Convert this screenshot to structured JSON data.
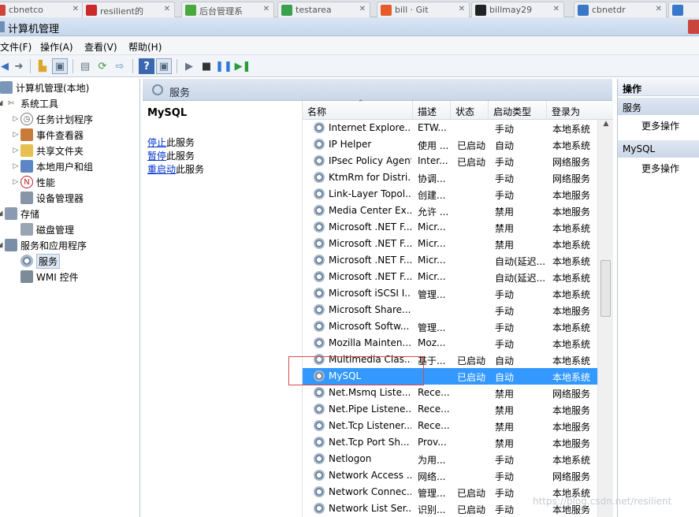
{
  "browser_tabs": [
    {
      "title": "cbnetco",
      "icon_color": "#d0433a"
    },
    {
      "title": "resilient的",
      "icon_color": "#cc2a2a"
    },
    {
      "title": "后台管理系",
      "icon_color": "#4aa83e"
    },
    {
      "title": "testarea",
      "icon_color": "#39a04c"
    },
    {
      "title": "bill · Git",
      "icon_color": "#e35c2a"
    },
    {
      "title": "billmay29",
      "icon_color": "#222222"
    },
    {
      "title": "cbnetdr",
      "icon_color": "#3a77c9"
    },
    {
      "title": "",
      "icon_color": "#3a77c9"
    }
  ],
  "window": {
    "title": "计算机管理"
  },
  "menu": [
    "文件(F)",
    "操作(A)",
    "查看(V)",
    "帮助(H)"
  ],
  "tree": {
    "root": "计算机管理(本地)",
    "system_tools": "系统工具",
    "task_scheduler": "任务计划程序",
    "event_viewer": "事件查看器",
    "shared_folders": "共享文件夹",
    "local_users": "本地用户和组",
    "performance": "性能",
    "device_manager": "设备管理器",
    "storage": "存储",
    "disk_management": "磁盘管理",
    "services_apps": "服务和应用程序",
    "services": "服务",
    "wmi": "WMI 控件"
  },
  "center": {
    "header_title": "服务",
    "selected_service": "MySQL",
    "stop_link": "停止",
    "stop_rest": "此服务",
    "pause_link": "暂停",
    "pause_rest": "此服务",
    "restart_link": "重启动",
    "restart_rest": "此服务"
  },
  "list": {
    "columns": [
      "名称",
      "描述",
      "状态",
      "启动类型",
      "登录为"
    ],
    "rows": [
      {
        "name": "Internet Explore...",
        "desc": "ETW...",
        "status": "",
        "startup": "手动",
        "logon": "本地系统"
      },
      {
        "name": "IP Helper",
        "desc": "使用 ...",
        "status": "已启动",
        "startup": "自动",
        "logon": "本地系统"
      },
      {
        "name": "IPsec Policy Agent",
        "desc": "Inter...",
        "status": "已启动",
        "startup": "手动",
        "logon": "网络服务"
      },
      {
        "name": "KtmRm for Distri...",
        "desc": "协调...",
        "status": "",
        "startup": "手动",
        "logon": "网络服务"
      },
      {
        "name": "Link-Layer Topol...",
        "desc": "创建...",
        "status": "",
        "startup": "手动",
        "logon": "本地服务"
      },
      {
        "name": "Media Center Ex...",
        "desc": "允许 ...",
        "status": "",
        "startup": "禁用",
        "logon": "本地服务"
      },
      {
        "name": "Microsoft .NET F...",
        "desc": "Micr...",
        "status": "",
        "startup": "禁用",
        "logon": "本地系统"
      },
      {
        "name": "Microsoft .NET F...",
        "desc": "Micr...",
        "status": "",
        "startup": "禁用",
        "logon": "本地系统"
      },
      {
        "name": "Microsoft .NET F...",
        "desc": "Micr...",
        "status": "",
        "startup": "自动(延迟...",
        "logon": "本地系统"
      },
      {
        "name": "Microsoft .NET F...",
        "desc": "Micr...",
        "status": "",
        "startup": "自动(延迟...",
        "logon": "本地系统"
      },
      {
        "name": "Microsoft iSCSI I...",
        "desc": "管理...",
        "status": "",
        "startup": "手动",
        "logon": "本地系统"
      },
      {
        "name": "Microsoft Share...",
        "desc": "",
        "status": "",
        "startup": "手动",
        "logon": "本地服务"
      },
      {
        "name": "Microsoft Softw...",
        "desc": "管理...",
        "status": "",
        "startup": "手动",
        "logon": "本地系统"
      },
      {
        "name": "Mozilla Mainten...",
        "desc": "Moz...",
        "status": "",
        "startup": "手动",
        "logon": "本地系统"
      },
      {
        "name": "Multimedia Clas...",
        "desc": "基于...",
        "status": "已启动",
        "startup": "自动",
        "logon": "本地系统"
      },
      {
        "name": "MySQL",
        "desc": "",
        "status": "已启动",
        "startup": "自动",
        "logon": "本地系统"
      },
      {
        "name": "Net.Msmq Liste...",
        "desc": "Rece...",
        "status": "",
        "startup": "禁用",
        "logon": "网络服务"
      },
      {
        "name": "Net.Pipe Listene...",
        "desc": "Rece...",
        "status": "",
        "startup": "禁用",
        "logon": "本地服务"
      },
      {
        "name": "Net.Tcp Listener...",
        "desc": "Rece...",
        "status": "",
        "startup": "禁用",
        "logon": "本地服务"
      },
      {
        "name": "Net.Tcp Port Sh...",
        "desc": "Prov...",
        "status": "",
        "startup": "禁用",
        "logon": "本地服务"
      },
      {
        "name": "Netlogon",
        "desc": "为用...",
        "status": "",
        "startup": "手动",
        "logon": "本地系统"
      },
      {
        "name": "Network Access ...",
        "desc": "网络...",
        "status": "",
        "startup": "手动",
        "logon": "网络服务"
      },
      {
        "name": "Network Connec...",
        "desc": "管理...",
        "status": "已启动",
        "startup": "手动",
        "logon": "本地系统"
      },
      {
        "name": "Network List Ser...",
        "desc": "识别...",
        "status": "已启动",
        "startup": "手动",
        "logon": "本地服务"
      }
    ],
    "selected_index": 15
  },
  "actions": {
    "title": "操作",
    "group1": "服务",
    "more1": "更多操作",
    "group2": "MySQL",
    "more2": "更多操作"
  },
  "watermark": "https://blog.csdn.net/resilient",
  "colors": {
    "selection": "#3399ff",
    "highlight_box": "#d94a4a",
    "link": "#0033cc"
  }
}
